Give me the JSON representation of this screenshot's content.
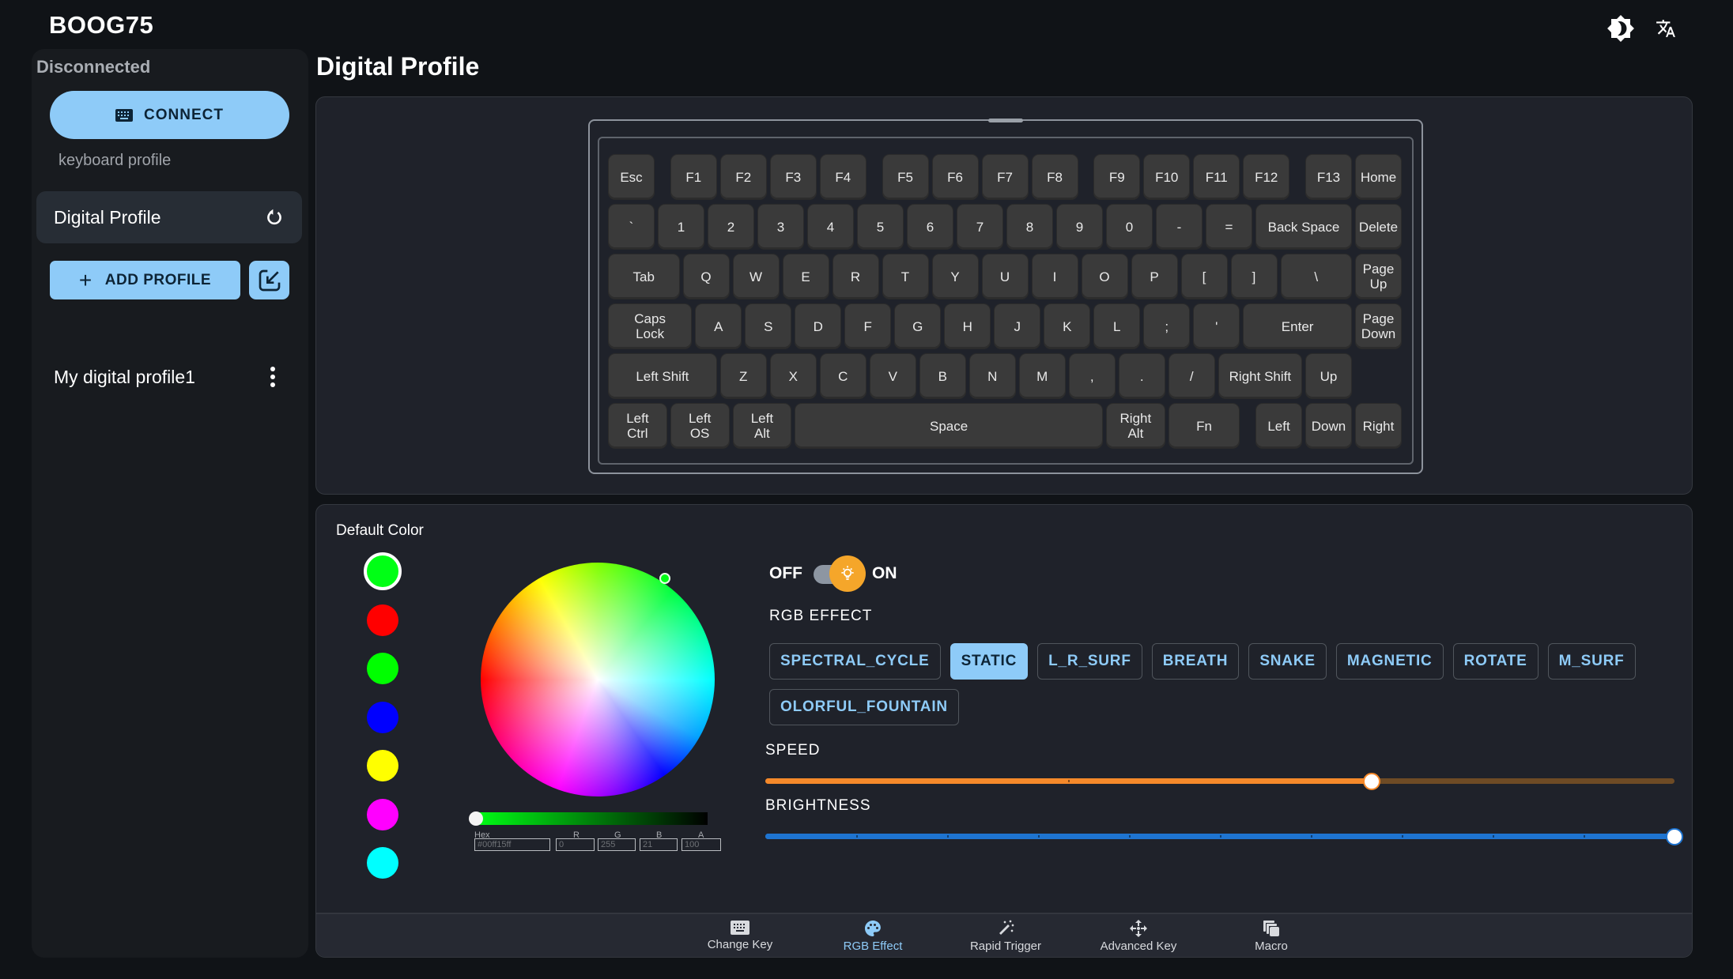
{
  "app": {
    "title": "BOOG75"
  },
  "topbar": {
    "icons": [
      "theme-brightness-icon",
      "translate-icon"
    ]
  },
  "sidebar": {
    "status": "Disconnected",
    "connect_label": "CONNECT",
    "section_label": "keyboard profile",
    "active_profile": "Digital Profile",
    "add_profile_label": "ADD PROFILE",
    "profiles": [
      "My digital profile1"
    ]
  },
  "page": {
    "title": "Digital Profile"
  },
  "keyboard": {
    "rows": [
      [
        {
          "l": "Esc",
          "w": 1
        },
        {
          "l": "F1",
          "w": 1,
          "g": 0.25
        },
        {
          "l": "F2",
          "w": 1
        },
        {
          "l": "F3",
          "w": 1
        },
        {
          "l": "F4",
          "w": 1
        },
        {
          "l": "F5",
          "w": 1,
          "g": 0.25
        },
        {
          "l": "F6",
          "w": 1
        },
        {
          "l": "F7",
          "w": 1
        },
        {
          "l": "F8",
          "w": 1
        },
        {
          "l": "F9",
          "w": 1,
          "g": 0.25
        },
        {
          "l": "F10",
          "w": 1
        },
        {
          "l": "F11",
          "w": 1
        },
        {
          "l": "F12",
          "w": 1
        },
        {
          "l": "F13",
          "w": 1,
          "g": 0.25
        },
        {
          "l": "Home",
          "w": 1
        }
      ],
      [
        {
          "l": "`",
          "w": 1
        },
        {
          "l": "1",
          "w": 1
        },
        {
          "l": "2",
          "w": 1
        },
        {
          "l": "3",
          "w": 1
        },
        {
          "l": "4",
          "w": 1
        },
        {
          "l": "5",
          "w": 1
        },
        {
          "l": "6",
          "w": 1
        },
        {
          "l": "7",
          "w": 1
        },
        {
          "l": "8",
          "w": 1
        },
        {
          "l": "9",
          "w": 1
        },
        {
          "l": "0",
          "w": 1
        },
        {
          "l": "-",
          "w": 1
        },
        {
          "l": "=",
          "w": 1
        },
        {
          "l": "Back Space",
          "w": 2
        },
        {
          "l": "Delete",
          "w": 1
        }
      ],
      [
        {
          "l": "Tab",
          "w": 1.5
        },
        {
          "l": "Q",
          "w": 1
        },
        {
          "l": "W",
          "w": 1
        },
        {
          "l": "E",
          "w": 1
        },
        {
          "l": "R",
          "w": 1
        },
        {
          "l": "T",
          "w": 1
        },
        {
          "l": "Y",
          "w": 1
        },
        {
          "l": "U",
          "w": 1
        },
        {
          "l": "I",
          "w": 1
        },
        {
          "l": "O",
          "w": 1
        },
        {
          "l": "P",
          "w": 1
        },
        {
          "l": "[",
          "w": 1
        },
        {
          "l": "]",
          "w": 1
        },
        {
          "l": "\\",
          "w": 1.5
        },
        {
          "l": "Page\nUp",
          "w": 1
        }
      ],
      [
        {
          "l": "Caps\nLock",
          "w": 1.75
        },
        {
          "l": "A",
          "w": 1
        },
        {
          "l": "S",
          "w": 1
        },
        {
          "l": "D",
          "w": 1
        },
        {
          "l": "F",
          "w": 1
        },
        {
          "l": "G",
          "w": 1
        },
        {
          "l": "H",
          "w": 1
        },
        {
          "l": "J",
          "w": 1
        },
        {
          "l": "K",
          "w": 1
        },
        {
          "l": "L",
          "w": 1
        },
        {
          "l": ";",
          "w": 1
        },
        {
          "l": "'",
          "w": 1
        },
        {
          "l": "Enter",
          "w": 2.25
        },
        {
          "l": "Page\nDown",
          "w": 1
        }
      ],
      [
        {
          "l": "Left Shift",
          "w": 2.25
        },
        {
          "l": "Z",
          "w": 1
        },
        {
          "l": "X",
          "w": 1
        },
        {
          "l": "C",
          "w": 1
        },
        {
          "l": "V",
          "w": 1
        },
        {
          "l": "B",
          "w": 1
        },
        {
          "l": "N",
          "w": 1
        },
        {
          "l": "M",
          "w": 1
        },
        {
          "l": ",",
          "w": 1
        },
        {
          "l": ".",
          "w": 1
        },
        {
          "l": "/",
          "w": 1
        },
        {
          "l": "Right Shift",
          "w": 1.75
        },
        {
          "l": "Up",
          "w": 1
        }
      ],
      [
        {
          "l": "Left\nCtrl",
          "w": 1.25
        },
        {
          "l": "Left\nOS",
          "w": 1.25
        },
        {
          "l": "Left\nAlt",
          "w": 1.25
        },
        {
          "l": "Space",
          "w": 6.25
        },
        {
          "l": "Right\nAlt",
          "w": 1.25
        },
        {
          "l": "Fn",
          "w": 1.5
        },
        {
          "l": "Left",
          "w": 1,
          "g": 0.25
        },
        {
          "l": "Down",
          "w": 1
        },
        {
          "l": "Right",
          "w": 1
        }
      ]
    ]
  },
  "color": {
    "label": "Default Color",
    "swatches": [
      "#00ff15",
      "#ff0000",
      "#00ff00",
      "#0000ff",
      "#ffff00",
      "#ff00ff",
      "#00ffff"
    ],
    "selected_swatch": 0,
    "hex_label": "Hex",
    "hex": "#00ff15ff",
    "r_label": "R",
    "r": "0",
    "g_label": "G",
    "g": "255",
    "b_label": "B",
    "b": "21",
    "a_label": "A",
    "a": "100",
    "alpha_fraction": 0.0
  },
  "lighting": {
    "off_label": "OFF",
    "on_label": "ON",
    "enabled": true,
    "effect_label": "RGB EFFECT",
    "effects": [
      "SPECTRAL_CYCLE",
      "STATIC",
      "L_R_SURF",
      "BREATH",
      "SNAKE",
      "MAGNETIC",
      "ROTATE",
      "M_SURF",
      "OLORFUL_FOUNTAIN"
    ],
    "active_effect": "STATIC",
    "speed_label": "SPEED",
    "speed": {
      "value": 2,
      "min": 0,
      "max": 3,
      "color": "#f5892a",
      "track": "#6e4b25"
    },
    "brightness_label": "BRIGHTNESS",
    "brightness": {
      "value": 10,
      "min": 0,
      "max": 10,
      "color": "#1e74d0",
      "track": "#1e74d0"
    }
  },
  "bottom_nav": {
    "items": [
      {
        "label": "Change Key",
        "icon": "keyboard-icon"
      },
      {
        "label": "RGB Effect",
        "icon": "palette-icon",
        "active": true
      },
      {
        "label": "Rapid Trigger",
        "icon": "magic-wand-icon"
      },
      {
        "label": "Advanced Key",
        "icon": "move-arrows-icon"
      },
      {
        "label": "Macro",
        "icon": "stack-copy-icon"
      }
    ]
  }
}
